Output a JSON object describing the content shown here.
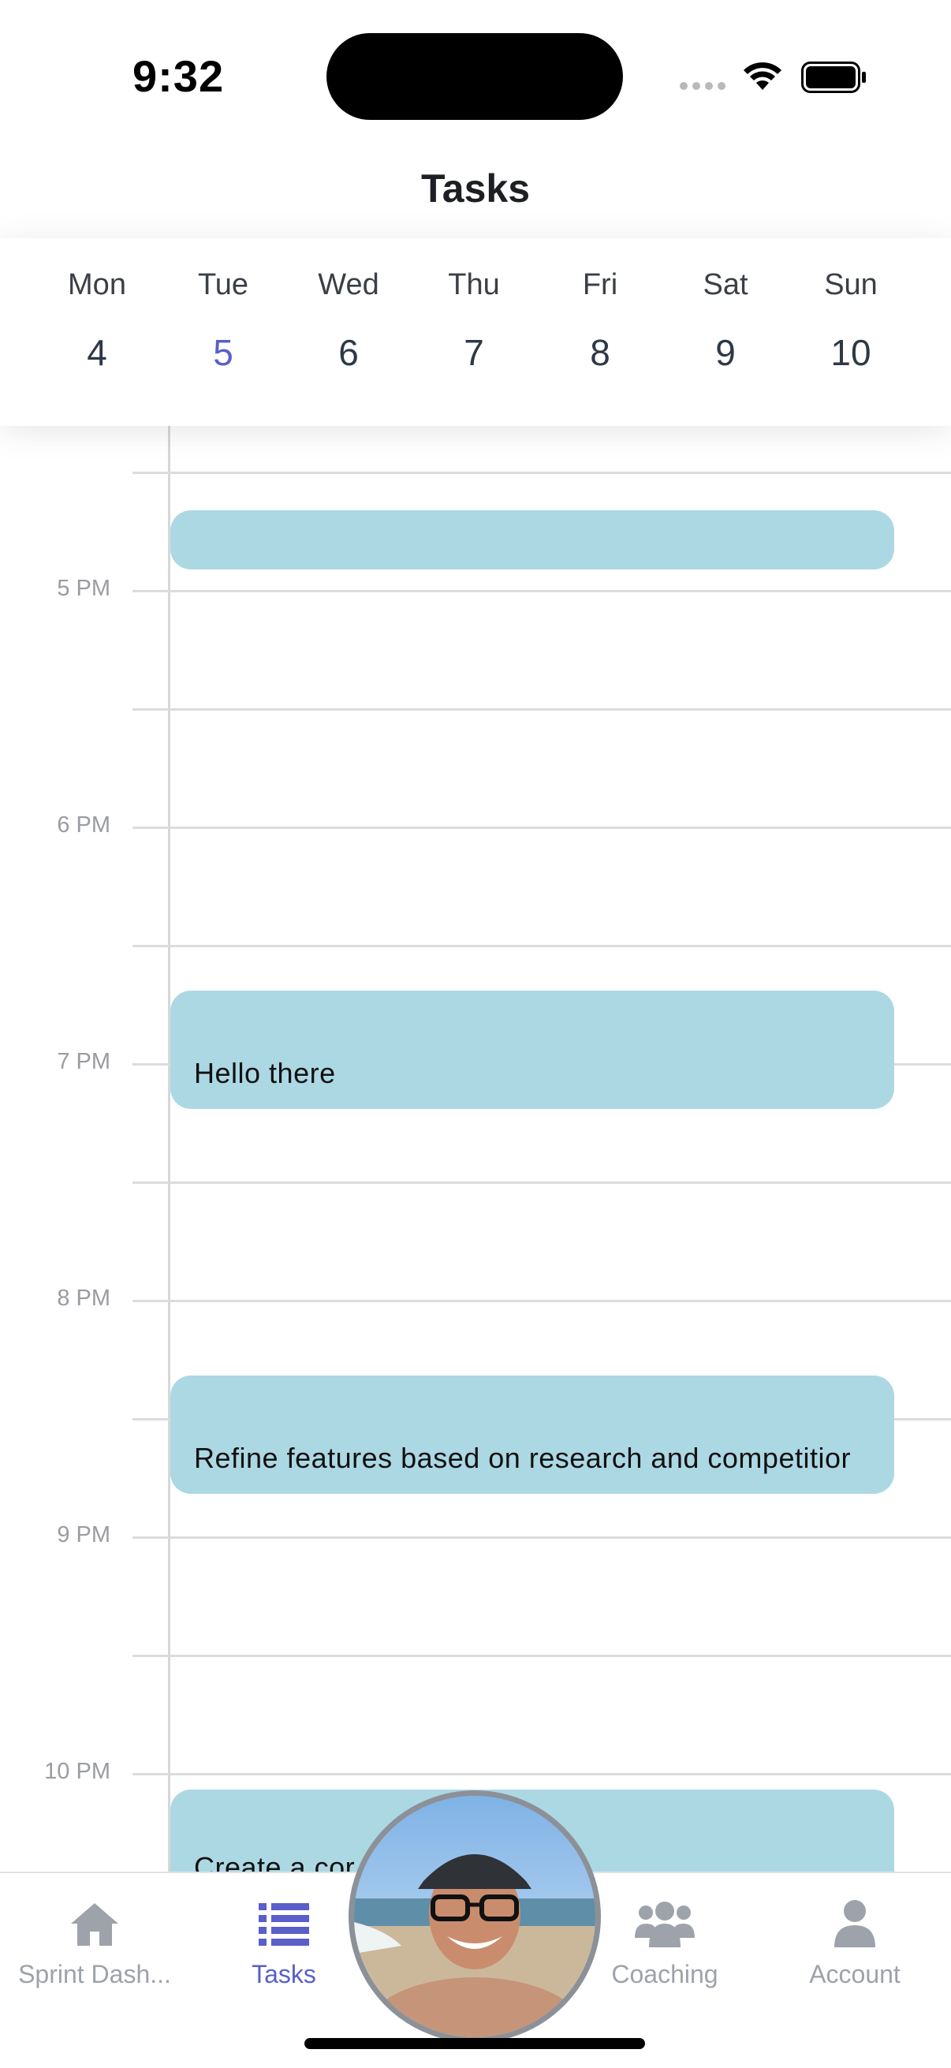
{
  "status_bar": {
    "time": "9:32"
  },
  "header": {
    "title": "Tasks"
  },
  "week": {
    "days": [
      {
        "name": "Mon",
        "date": "4"
      },
      {
        "name": "Tue",
        "date": "5"
      },
      {
        "name": "Wed",
        "date": "6"
      },
      {
        "name": "Thu",
        "date": "7"
      },
      {
        "name": "Fri",
        "date": "8"
      },
      {
        "name": "Sat",
        "date": "9"
      },
      {
        "name": "Sun",
        "date": "10"
      }
    ],
    "selected_date": "5"
  },
  "timeline": {
    "hours": [
      "5 PM",
      "6 PM",
      "7 PM",
      "8 PM",
      "9 PM",
      "10 PM"
    ],
    "events": [
      {
        "title": ""
      },
      {
        "title": "Hello there"
      },
      {
        "title": "Refine features based on research and competitior"
      },
      {
        "title": "Create a cor"
      }
    ]
  },
  "tab_bar": {
    "tabs": [
      {
        "label": "Sprint Dash...",
        "icon": "home-icon"
      },
      {
        "label": "Tasks",
        "icon": "list-icon"
      },
      {
        "label": "Coaching",
        "icon": "people-icon"
      },
      {
        "label": "Account",
        "icon": "person-icon"
      }
    ],
    "active_tab": "Tasks",
    "center": {
      "icon": "profile-photo"
    }
  },
  "colors": {
    "accent": "#5a5fc9",
    "event_fill": "#acd8e4",
    "inactive_tab": "#9ea2aa",
    "gridline": "#dcdcde"
  }
}
